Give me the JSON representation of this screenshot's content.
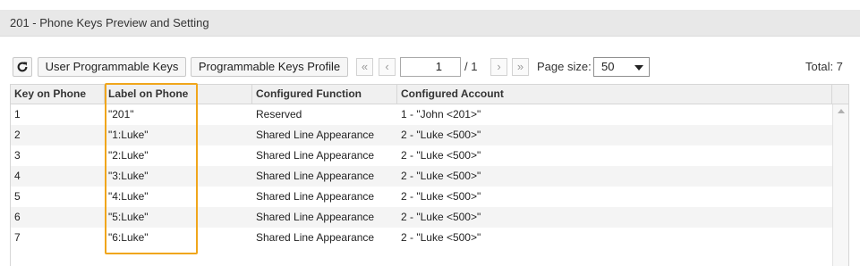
{
  "header": {
    "title": "201 - Phone Keys Preview and Setting"
  },
  "toolbar": {
    "refresh_icon": "refresh-icon",
    "user_keys_label": "User Programmable Keys",
    "profile_keys_label": "Programmable Keys Profile",
    "first_icon": "«",
    "prev_icon": "‹",
    "next_icon": "›",
    "last_icon": "»",
    "page_current": "1",
    "page_of": "/ 1",
    "page_size_label": "Page size:",
    "page_size_value": "50",
    "total_label": "Total: 7"
  },
  "table": {
    "columns": [
      "Key on Phone",
      "Label on Phone",
      "Configured Function",
      "Configured Account"
    ],
    "rows": [
      [
        "1",
        "\"201\"",
        "Reserved",
        "1 - \"John <201>\""
      ],
      [
        "2",
        "\"1:Luke\"",
        "Shared Line Appearance",
        "2 - \"Luke <500>\""
      ],
      [
        "3",
        "\"2:Luke\"",
        "Shared Line Appearance",
        "2 - \"Luke <500>\""
      ],
      [
        "4",
        "\"3:Luke\"",
        "Shared Line Appearance",
        "2 - \"Luke <500>\""
      ],
      [
        "5",
        "\"4:Luke\"",
        "Shared Line Appearance",
        "2 - \"Luke <500>\""
      ],
      [
        "6",
        "\"5:Luke\"",
        "Shared Line Appearance",
        "2 - \"Luke <500>\""
      ],
      [
        "7",
        "\"6:Luke\"",
        "Shared Line Appearance",
        "2 - \"Luke <500>\""
      ]
    ]
  },
  "colors": {
    "highlight": "#f0a61c",
    "header_bg": "#e8e8e8",
    "row_alt": "#f4f4f4"
  }
}
